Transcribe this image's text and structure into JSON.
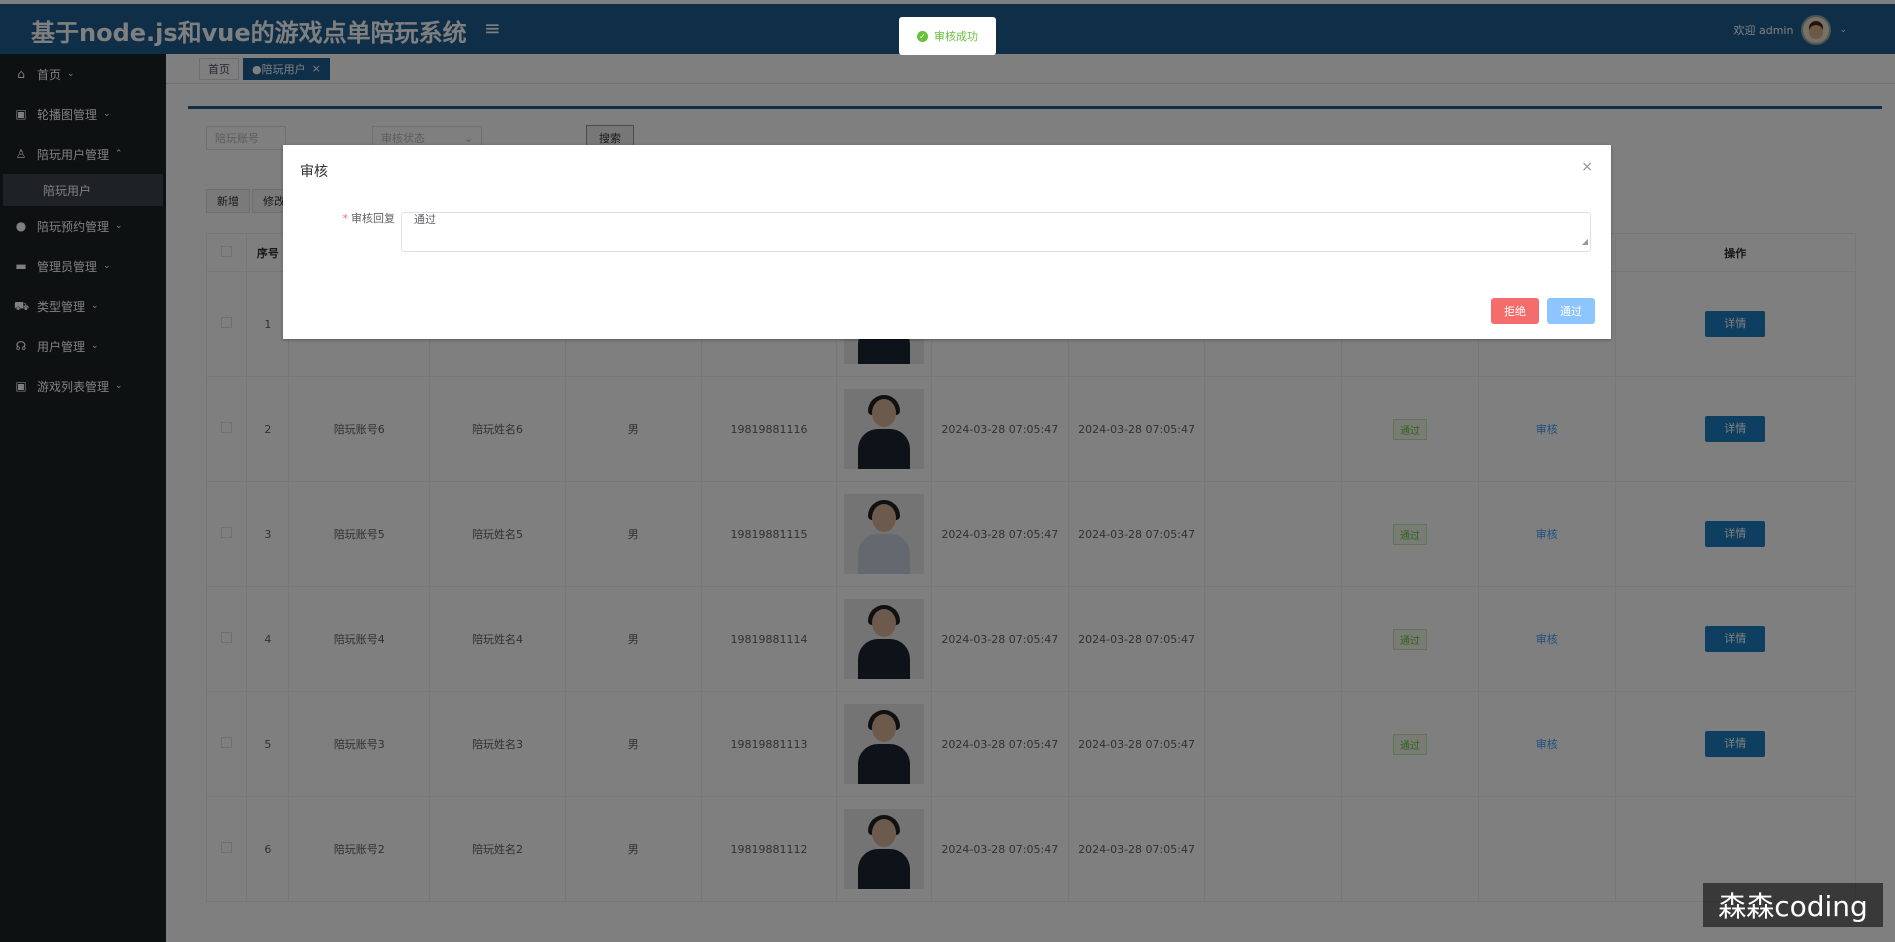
{
  "header": {
    "title": "基于node.js和vue的游戏点单陪玩系统",
    "welcome": "欢迎 admin"
  },
  "sidebar": {
    "items": [
      {
        "label": "首页",
        "icon": "home-icon"
      },
      {
        "label": "轮播图管理",
        "icon": "image-icon"
      },
      {
        "label": "陪玩用户管理",
        "icon": "user-icon"
      },
      {
        "label": "陪玩预约管理",
        "icon": "check-circle-icon"
      },
      {
        "label": "管理员管理",
        "icon": "document-icon"
      },
      {
        "label": "类型管理",
        "icon": "car-icon"
      },
      {
        "label": "用户管理",
        "icon": "headset-icon"
      },
      {
        "label": "游戏列表管理",
        "icon": "image-icon"
      }
    ],
    "sub_item": "陪玩用户"
  },
  "tabs": [
    {
      "label": "首页"
    },
    {
      "label": "●陪玩用户"
    }
  ],
  "search": {
    "account_placeholder": "陪玩账号",
    "status_placeholder": "审核状态",
    "search_label": "搜索"
  },
  "actions": {
    "add_label": "新增",
    "edit_label": "修改"
  },
  "table": {
    "headers": {
      "index": "序号",
      "operation": "操作"
    },
    "rows": [
      {
        "index": "1",
        "account": "",
        "name": "",
        "gender": "",
        "phone": "",
        "created": "",
        "updated": "",
        "status": "",
        "audit": "",
        "detail": "详情"
      },
      {
        "index": "2",
        "account": "陪玩账号6",
        "name": "陪玩姓名6",
        "gender": "男",
        "phone": "19819881116",
        "created": "2024-03-28 07:05:47",
        "updated": "2024-03-28 07:05:47",
        "status": "通过",
        "audit": "审核",
        "detail": "详情"
      },
      {
        "index": "3",
        "account": "陪玩账号5",
        "name": "陪玩姓名5",
        "gender": "男",
        "phone": "19819881115",
        "created": "2024-03-28 07:05:47",
        "updated": "2024-03-28 07:05:47",
        "status": "通过",
        "audit": "审核",
        "detail": "详情"
      },
      {
        "index": "4",
        "account": "陪玩账号4",
        "name": "陪玩姓名4",
        "gender": "男",
        "phone": "19819881114",
        "created": "2024-03-28 07:05:47",
        "updated": "2024-03-28 07:05:47",
        "status": "通过",
        "audit": "审核",
        "detail": "详情"
      },
      {
        "index": "5",
        "account": "陪玩账号3",
        "name": "陪玩姓名3",
        "gender": "男",
        "phone": "19819881113",
        "created": "2024-03-28 07:05:47",
        "updated": "2024-03-28 07:05:47",
        "status": "通过",
        "audit": "审核",
        "detail": "详情"
      },
      {
        "index": "6",
        "account": "陪玩账号2",
        "name": "陪玩姓名2",
        "gender": "男",
        "phone": "19819881112",
        "created": "2024-03-28 07:05:47",
        "updated": "2024-03-28 07:05:47",
        "status": "",
        "audit": "",
        "detail": ""
      }
    ]
  },
  "dialog": {
    "title": "审核",
    "field_label": "审核回复",
    "field_value": "通过",
    "reject_label": "拒绝",
    "pass_label": "通过"
  },
  "toast": {
    "message": "审核成功"
  },
  "watermark": "森森coding",
  "colors": {
    "header": "#1f5f92",
    "sidebar": "#1d2225",
    "primary_button": "#1f7fc0",
    "reject": "#f56c6c",
    "success": "#67c23a"
  }
}
